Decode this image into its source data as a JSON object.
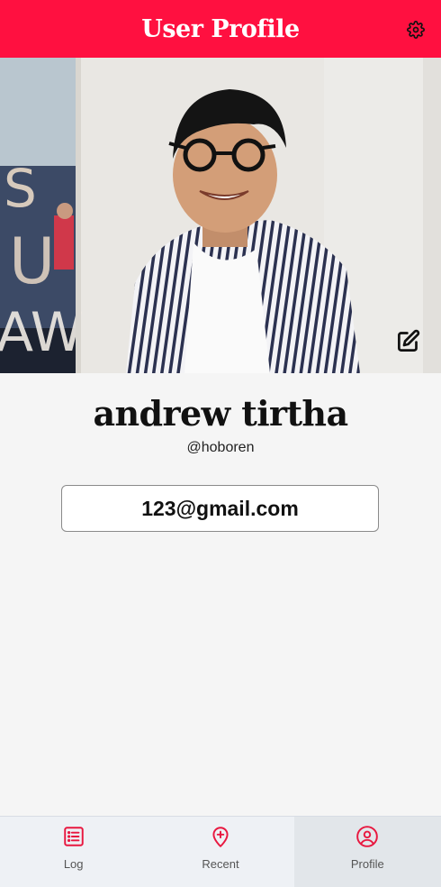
{
  "header": {
    "title": "User Profile",
    "settings_icon": "gear-icon"
  },
  "profile": {
    "name": "andrew tirtha",
    "handle": "@hoboren",
    "email": "123@gmail.com",
    "edit_icon": "edit-icon"
  },
  "tabs": [
    {
      "label": "Log",
      "icon": "list-icon",
      "active": false
    },
    {
      "label": "Recent",
      "icon": "map-pin-plus-icon",
      "active": false
    },
    {
      "label": "Profile",
      "icon": "user-circle-icon",
      "active": true
    }
  ],
  "colors": {
    "brand": "#ff1040",
    "tab_icon": "#e8173f",
    "background": "#f5f5f5",
    "tabbar": "#eef1f5"
  }
}
